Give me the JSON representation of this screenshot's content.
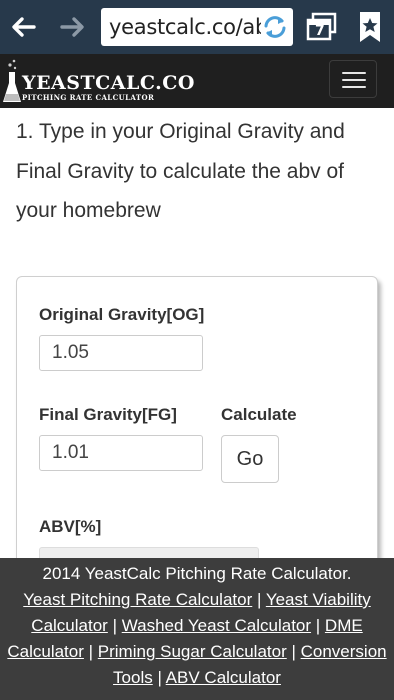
{
  "browser": {
    "url": "yeastcalc.co/abv",
    "tab_count": "7"
  },
  "site": {
    "title": "YEASTCALC.CO",
    "subtitle": "PITCHING RATE CALCULATOR"
  },
  "intro": {
    "text": "1. Type in your Original Gravity and Final Gravity to calculate the abv of your homebrew"
  },
  "form": {
    "og_label": "Original Gravity[OG]",
    "og_value": "1.05",
    "fg_label": "Final Gravity[FG]",
    "fg_value": "1.01",
    "calculate_label": "Calculate",
    "go_label": "Go",
    "abv_label": "ABV[%]"
  },
  "footer": {
    "copyright": "2014 YeastCalc Pitching Rate Calculator.",
    "sep": " | ",
    "links": [
      "Yeast Pitching Rate Calculator",
      "Yeast Viability Calculator",
      "Washed Yeast Calculator",
      "DME Calculator",
      "Priming Sugar Calculator",
      "Conversion Tools",
      "ABV Calculator"
    ]
  },
  "icons": {
    "back": "arrow-left-icon",
    "forward": "arrow-right-icon",
    "reload": "reload-icon",
    "tabs": "tabs-icon",
    "bookmark": "bookmark-star-icon",
    "menu": "hamburger-icon",
    "logo": "flask-icon"
  },
  "colors": {
    "browser_bar": "#27394b",
    "header": "#1f1f1f",
    "footer": "#3d3d3d",
    "reload_accent": "#4a9ed8"
  }
}
